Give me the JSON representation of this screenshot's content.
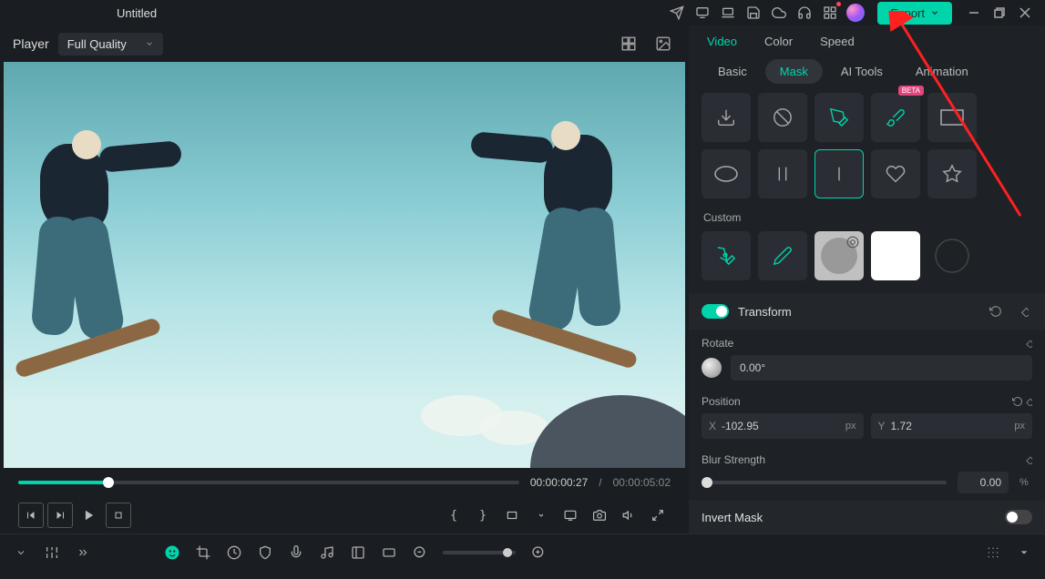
{
  "titlebar": {
    "title": "Untitled",
    "export_label": "Export"
  },
  "player": {
    "label": "Player",
    "quality": "Full Quality",
    "time_current": "00:00:00:27",
    "separator": "/",
    "time_total": "00:00:05:02"
  },
  "tabs": {
    "top": [
      "Video",
      "Color",
      "Speed"
    ],
    "top_active": 0,
    "sub": [
      "Basic",
      "Mask",
      "AI Tools",
      "Animation"
    ],
    "sub_active": 1
  },
  "mask": {
    "beta_badge": "BETA",
    "custom_label": "Custom"
  },
  "transform": {
    "label": "Transform",
    "rotate_label": "Rotate",
    "rotate_value": "0.00°",
    "position_label": "Position",
    "x_label": "X",
    "x_value": "-102.95",
    "x_unit": "px",
    "y_label": "Y",
    "y_value": "1.72",
    "y_unit": "px",
    "blur_label": "Blur Strength",
    "blur_value": "0.00",
    "blur_unit": "%",
    "invert_label": "Invert Mask"
  }
}
